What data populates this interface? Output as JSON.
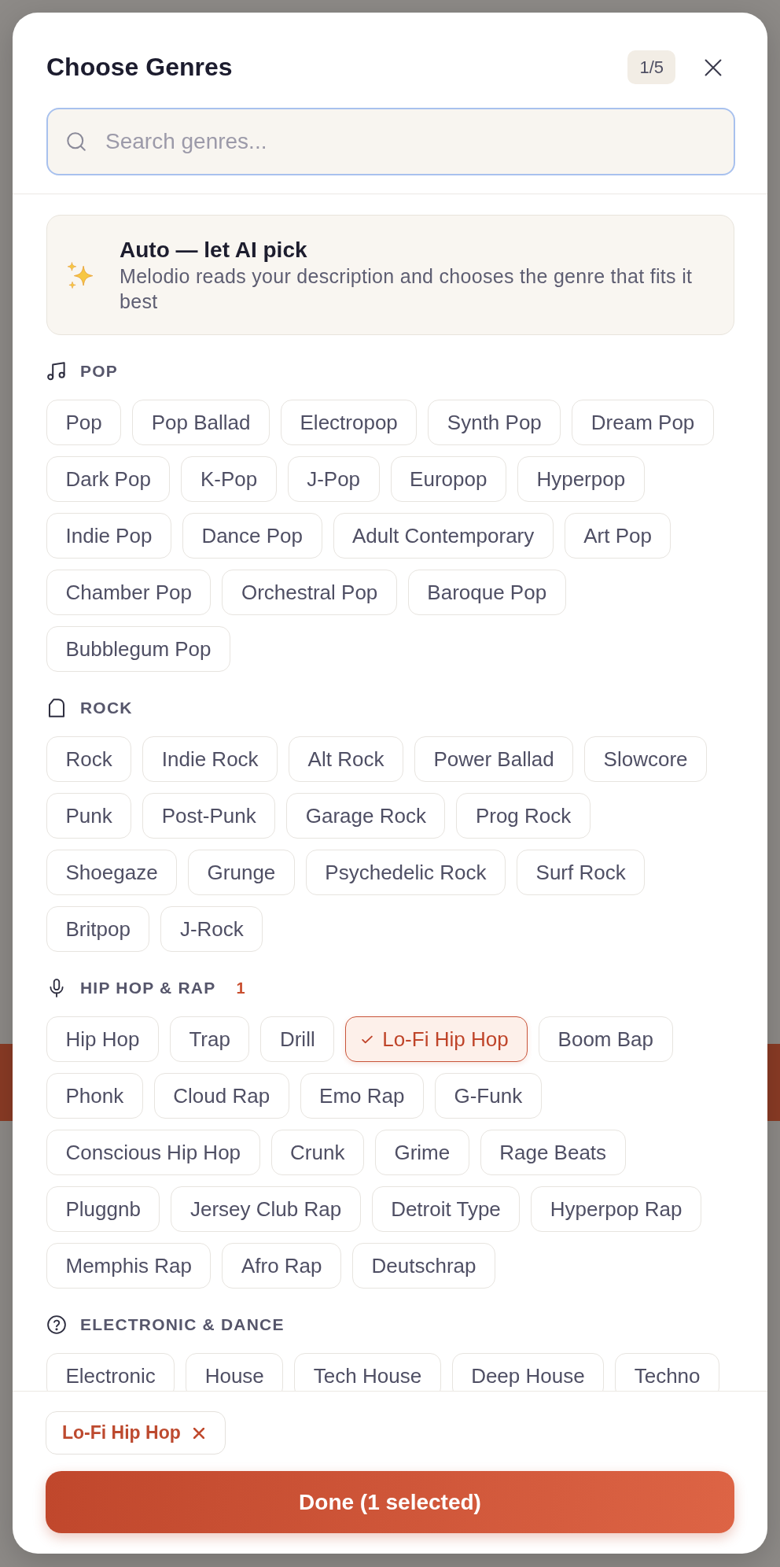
{
  "dialog": {
    "title": "Choose Genres",
    "step": "1/5"
  },
  "search": {
    "placeholder": "Search genres..."
  },
  "auto_option": {
    "title": "Auto — let AI pick",
    "description": "Melodio reads your description and chooses the genre that fits it best"
  },
  "categories": [
    {
      "name": "POP",
      "genres": [
        {
          "label": "Pop",
          "selected": false
        },
        {
          "label": "Pop Ballad",
          "selected": false
        },
        {
          "label": "Electropop",
          "selected": false
        },
        {
          "label": "Synth Pop",
          "selected": false
        },
        {
          "label": "Dream Pop",
          "selected": false
        },
        {
          "label": "Dark Pop",
          "selected": false
        },
        {
          "label": "K-Pop",
          "selected": false
        },
        {
          "label": "J-Pop",
          "selected": false
        },
        {
          "label": "Europop",
          "selected": false
        },
        {
          "label": "Hyperpop",
          "selected": false
        },
        {
          "label": "Indie Pop",
          "selected": false
        },
        {
          "label": "Dance Pop",
          "selected": false
        },
        {
          "label": "Adult Contemporary",
          "selected": false
        },
        {
          "label": "Art Pop",
          "selected": false
        },
        {
          "label": "Chamber Pop",
          "selected": false
        },
        {
          "label": "Orchestral Pop",
          "selected": false
        },
        {
          "label": "Baroque Pop",
          "selected": false
        },
        {
          "label": "Bubblegum Pop",
          "selected": false
        }
      ]
    },
    {
      "name": "ROCK",
      "genres": [
        {
          "label": "Rock",
          "selected": false
        },
        {
          "label": "Indie Rock",
          "selected": false
        },
        {
          "label": "Alt Rock",
          "selected": false
        },
        {
          "label": "Power Ballad",
          "selected": false
        },
        {
          "label": "Slowcore",
          "selected": false
        },
        {
          "label": "Punk",
          "selected": false
        },
        {
          "label": "Post-Punk",
          "selected": false
        },
        {
          "label": "Garage Rock",
          "selected": false
        },
        {
          "label": "Prog Rock",
          "selected": false
        },
        {
          "label": "Shoegaze",
          "selected": false
        },
        {
          "label": "Grunge",
          "selected": false
        },
        {
          "label": "Psychedelic Rock",
          "selected": false
        },
        {
          "label": "Surf Rock",
          "selected": false
        },
        {
          "label": "Britpop",
          "selected": false
        },
        {
          "label": "J-Rock",
          "selected": false
        }
      ]
    },
    {
      "name": "HIP HOP & RAP",
      "count": "1",
      "genres": [
        {
          "label": "Hip Hop",
          "selected": false
        },
        {
          "label": "Trap",
          "selected": false
        },
        {
          "label": "Drill",
          "selected": false
        },
        {
          "label": "Lo-Fi Hip Hop",
          "selected": true
        },
        {
          "label": "Boom Bap",
          "selected": false
        },
        {
          "label": "Phonk",
          "selected": false
        },
        {
          "label": "Cloud Rap",
          "selected": false
        },
        {
          "label": "Emo Rap",
          "selected": false
        },
        {
          "label": "G-Funk",
          "selected": false
        },
        {
          "label": "Conscious Hip Hop",
          "selected": false
        },
        {
          "label": "Crunk",
          "selected": false
        },
        {
          "label": "Grime",
          "selected": false
        },
        {
          "label": "Rage Beats",
          "selected": false
        },
        {
          "label": "Pluggnb",
          "selected": false
        },
        {
          "label": "Jersey Club Rap",
          "selected": false
        },
        {
          "label": "Detroit Type",
          "selected": false
        },
        {
          "label": "Hyperpop Rap",
          "selected": false
        },
        {
          "label": "Memphis Rap",
          "selected": false
        },
        {
          "label": "Afro Rap",
          "selected": false
        },
        {
          "label": "Deutschrap",
          "selected": false
        }
      ]
    },
    {
      "name": "ELECTRONIC & DANCE",
      "genres": [
        {
          "label": "Electronic",
          "selected": false
        },
        {
          "label": "House",
          "selected": false
        },
        {
          "label": "Tech House",
          "selected": false
        },
        {
          "label": "Deep House",
          "selected": false
        },
        {
          "label": "Techno",
          "selected": false
        }
      ]
    }
  ],
  "selected_tags": [
    {
      "label": "Lo-Fi Hip Hop"
    }
  ],
  "done_button": {
    "label": "Done (1 selected)"
  }
}
